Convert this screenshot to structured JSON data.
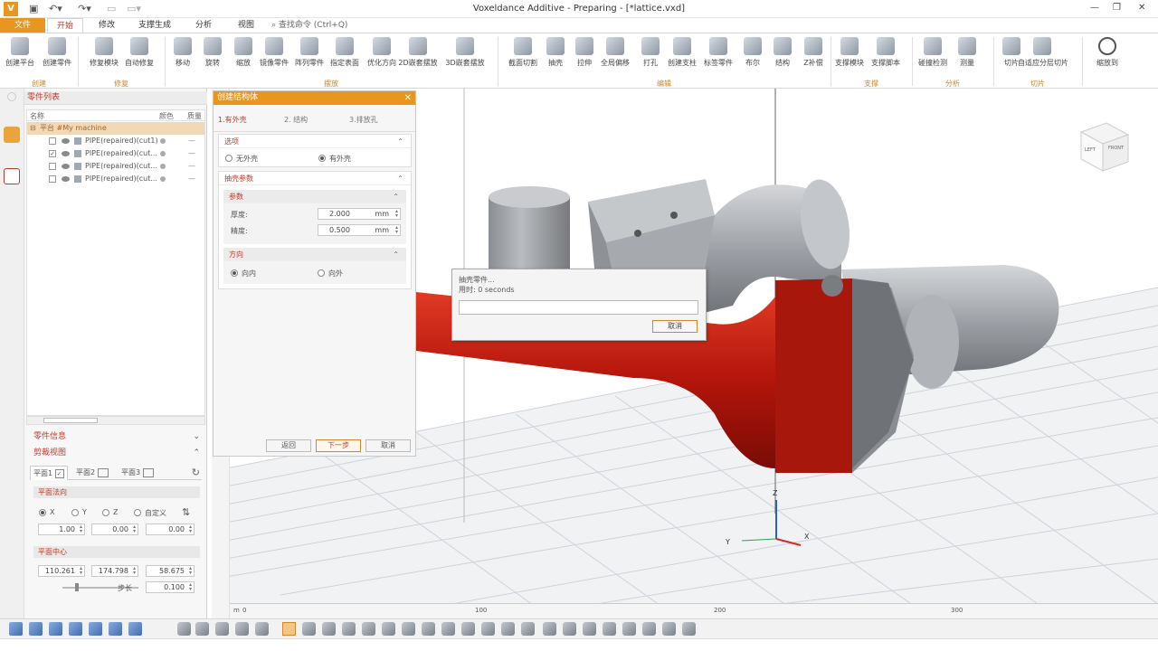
{
  "app": {
    "title": "Voxeldance Additive - Preparing - [*lattice.vxd]",
    "quick_access": [
      "save",
      "undo",
      "redo",
      "new"
    ]
  },
  "ribbon_tabs": [
    {
      "label": "文件",
      "state": "file"
    },
    {
      "label": "开始",
      "state": "active"
    },
    {
      "label": "修改",
      "state": "normal"
    },
    {
      "label": "支撑生成",
      "state": "normal"
    },
    {
      "label": "分析",
      "state": "normal"
    },
    {
      "label": "视图",
      "state": "normal"
    }
  ],
  "search": {
    "label": "查找命令 (Ctrl+Q)"
  },
  "ribbon": {
    "buttons": [
      {
        "label": "创建平台"
      },
      {
        "label": "创建零件"
      },
      {
        "label": "修复模块"
      },
      {
        "label": "自动修复"
      },
      {
        "label": "移动"
      },
      {
        "label": "旋转"
      },
      {
        "label": "缩放"
      },
      {
        "label": "镜像零件"
      },
      {
        "label": "阵列零件"
      },
      {
        "label": "指定表面"
      },
      {
        "label": "优化方向"
      },
      {
        "label": "2D嵌套摆放"
      },
      {
        "label": "3D嵌套摆放"
      },
      {
        "label": "截面切割"
      },
      {
        "label": "抽壳"
      },
      {
        "label": "拉伸"
      },
      {
        "label": "全局偏移"
      },
      {
        "label": "打孔"
      },
      {
        "label": "创建支柱"
      },
      {
        "label": "标签零件"
      },
      {
        "label": "布尔"
      },
      {
        "label": "结构"
      },
      {
        "label": "Z补偿"
      },
      {
        "label": "支撑模块"
      },
      {
        "label": "支撑脚本"
      },
      {
        "label": "碰撞检测"
      },
      {
        "label": "测量"
      },
      {
        "label": "切片"
      },
      {
        "label": "自适应分层切片"
      },
      {
        "label": "缩放到"
      }
    ],
    "groups": [
      "创建",
      "修复",
      "摆放",
      "编辑",
      "支撑",
      "分析",
      "切片"
    ]
  },
  "parts_panel": {
    "title": "零件列表",
    "columns": [
      "名称",
      "颜色",
      "质量"
    ],
    "root": "平台 #My machine",
    "parts": [
      {
        "name": "PIPE(repaired)(cut1)",
        "checked": false,
        "mass": "—"
      },
      {
        "name": "PIPE(repaired)(cut...",
        "checked": true,
        "mass": "—"
      },
      {
        "name": "PIPE(repaired)(cut...",
        "checked": false,
        "mass": "—"
      },
      {
        "name": "PIPE(repaired)(cut...",
        "checked": false,
        "mass": "—"
      }
    ]
  },
  "part_info": {
    "title": "零件信息"
  },
  "clip_view": {
    "title": "剪裁视图",
    "tabs": [
      "平面1",
      "平面2",
      "平面3"
    ],
    "normal_title": "平面法向",
    "normal_options": [
      "X",
      "Y",
      "Z",
      "自定义"
    ],
    "normal_values": [
      "1.00",
      "0.00",
      "0.00"
    ],
    "center_title": "平面中心",
    "center_values": [
      "110.261",
      "174.798",
      "58.675"
    ],
    "step_label": "步长",
    "step_value": "0.100"
  },
  "wizard": {
    "title": "创建结构体",
    "steps": [
      "1.有外壳",
      "2. 结构",
      "3.排放孔"
    ],
    "options": {
      "title": "选项",
      "choices": [
        "无外壳",
        "有外壳"
      ],
      "selected": "有外壳"
    },
    "shell": {
      "title": "抽壳参数",
      "params_title": "参数",
      "thickness_label": "厚度:",
      "thickness_value": "2.000",
      "precision_label": "精度:",
      "precision_value": "0.500",
      "unit": "mm",
      "direction_title": "方向",
      "directions": [
        "向内",
        "向外"
      ],
      "direction_selected": "向内"
    },
    "buttons": {
      "back": "返回",
      "next": "下一步",
      "cancel": "取消"
    }
  },
  "progress": {
    "title": "抽壳零件...",
    "elapsed": "用时: 0 seconds",
    "percent": 0,
    "cancel": "取消"
  },
  "view_cube": {
    "faces": [
      "LEFT",
      "FRONT"
    ]
  },
  "axes": {
    "x": "X",
    "y": "Y",
    "z": "Z"
  },
  "ruler": {
    "unit": "m",
    "ticks": [
      "0",
      "100",
      "200",
      "300"
    ]
  },
  "colors": {
    "accent": "#e8961e",
    "accent_text": "#c0392b",
    "part_red": "#c41a0f",
    "part_gray": "#a9acb0"
  }
}
